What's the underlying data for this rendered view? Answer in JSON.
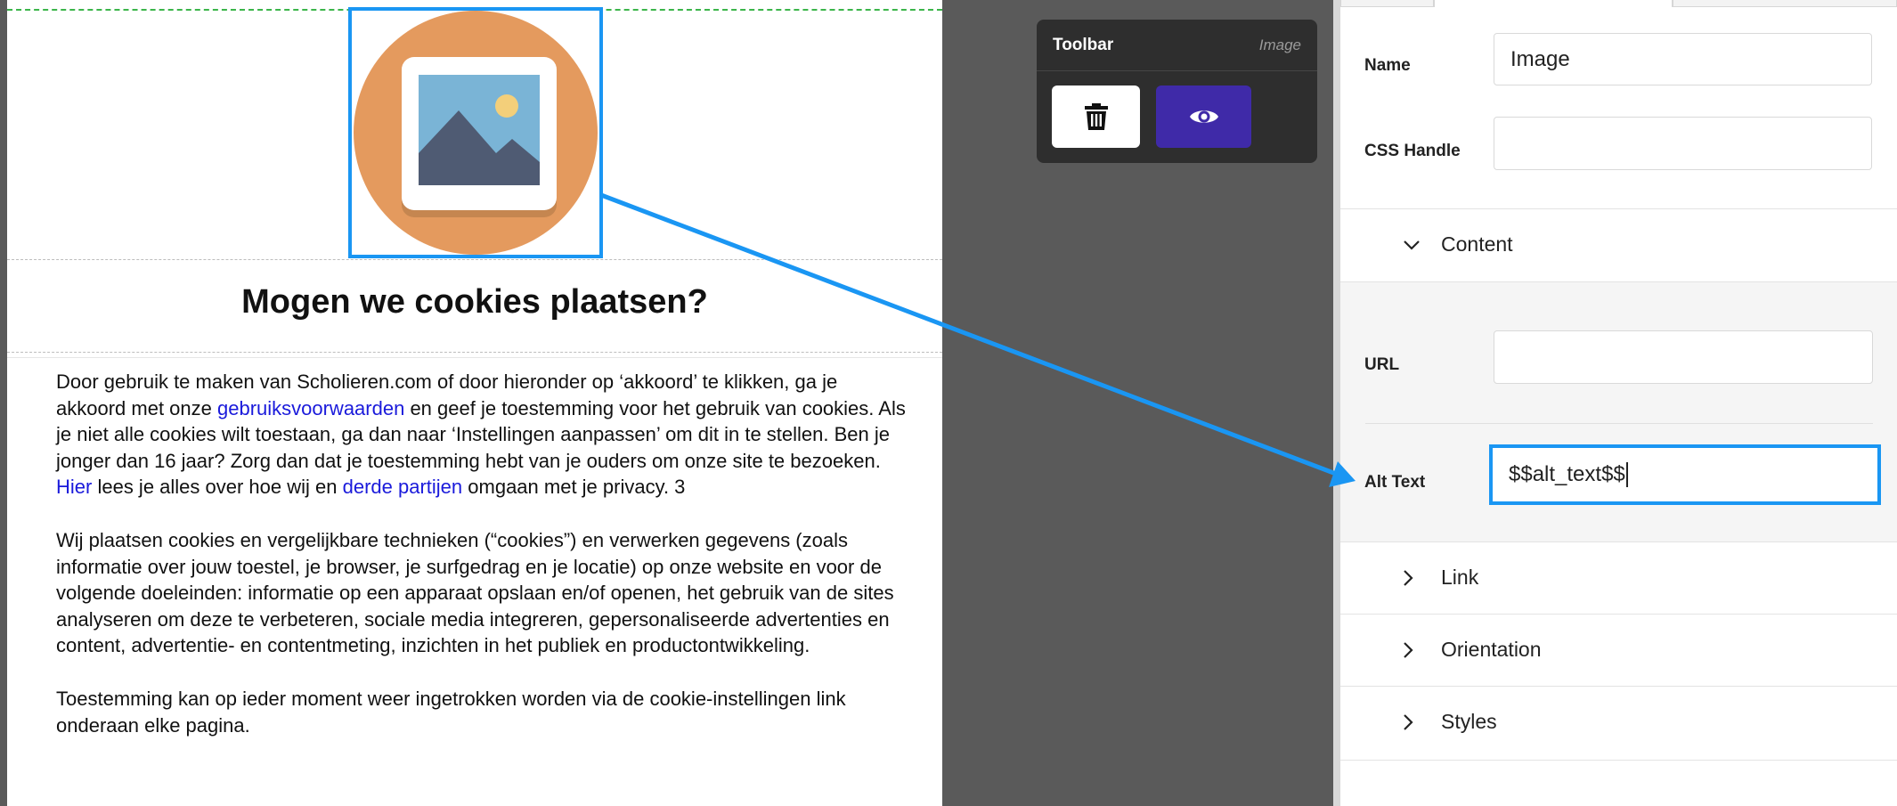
{
  "canvas": {
    "modal_title": "Mogen we cookies plaatsen?",
    "paragraph1": {
      "part1": "Door gebruik te maken van Scholieren.com of door hieronder op ‘akkoord’ te klikken, ga je akkoord met onze ",
      "link_terms": "gebruiksvoorwaarden",
      "part2": " en geef je toestemming voor het gebruik van cookies. Als je niet alle cookies wilt toestaan, ga dan naar ‘Instellingen aanpassen’ om dit in te stellen. Ben je jonger dan 16 jaar? Zorg dan dat je toestemming hebt van je ouders om onze site te bezoeken. ",
      "link_here": "Hier",
      "part3": " lees je alles over hoe wij en ",
      "link_third": "derde partijen",
      "part4": " omgaan met je privacy. 3"
    },
    "paragraph2": "Wij plaatsen cookies en vergelijkbare technieken (“cookies”) en verwerken gegevens (zoals informatie over jouw toestel, je browser, je surfgedrag en je locatie) op onze website en voor de volgende doeleinden: informatie op een apparaat opslaan en/of openen, het gebruik van de sites analyseren om deze te verbeteren, sociale media integreren, gepersonaliseerde advertenties en content, advertentie- en contentmeting, inzichten in het publiek en productontwikkeling.",
    "paragraph3": "Toestemming kan op ieder moment weer ingetrokken worden via de cookie-instellingen link onderaan elke pagina.",
    "image_icon": "image-placeholder-icon"
  },
  "toolbar": {
    "title": "Toolbar",
    "element_type": "Image",
    "delete_icon": "trash-icon",
    "preview_icon": "eye-icon"
  },
  "panel": {
    "name_label": "Name",
    "name_value": "Image",
    "css_handle_label": "CSS Handle",
    "css_handle_value": "",
    "sections": {
      "content": "Content",
      "link": "Link",
      "orientation": "Orientation",
      "styles": "Styles"
    },
    "url_label": "URL",
    "url_value": "",
    "alt_text_label": "Alt Text",
    "alt_text_value": "$$alt_text$$"
  },
  "colors": {
    "highlight": "#1a96f3",
    "preview_button": "#3f2aa8",
    "link": "#1a1adb",
    "icon_circle": "#e49a5e"
  }
}
